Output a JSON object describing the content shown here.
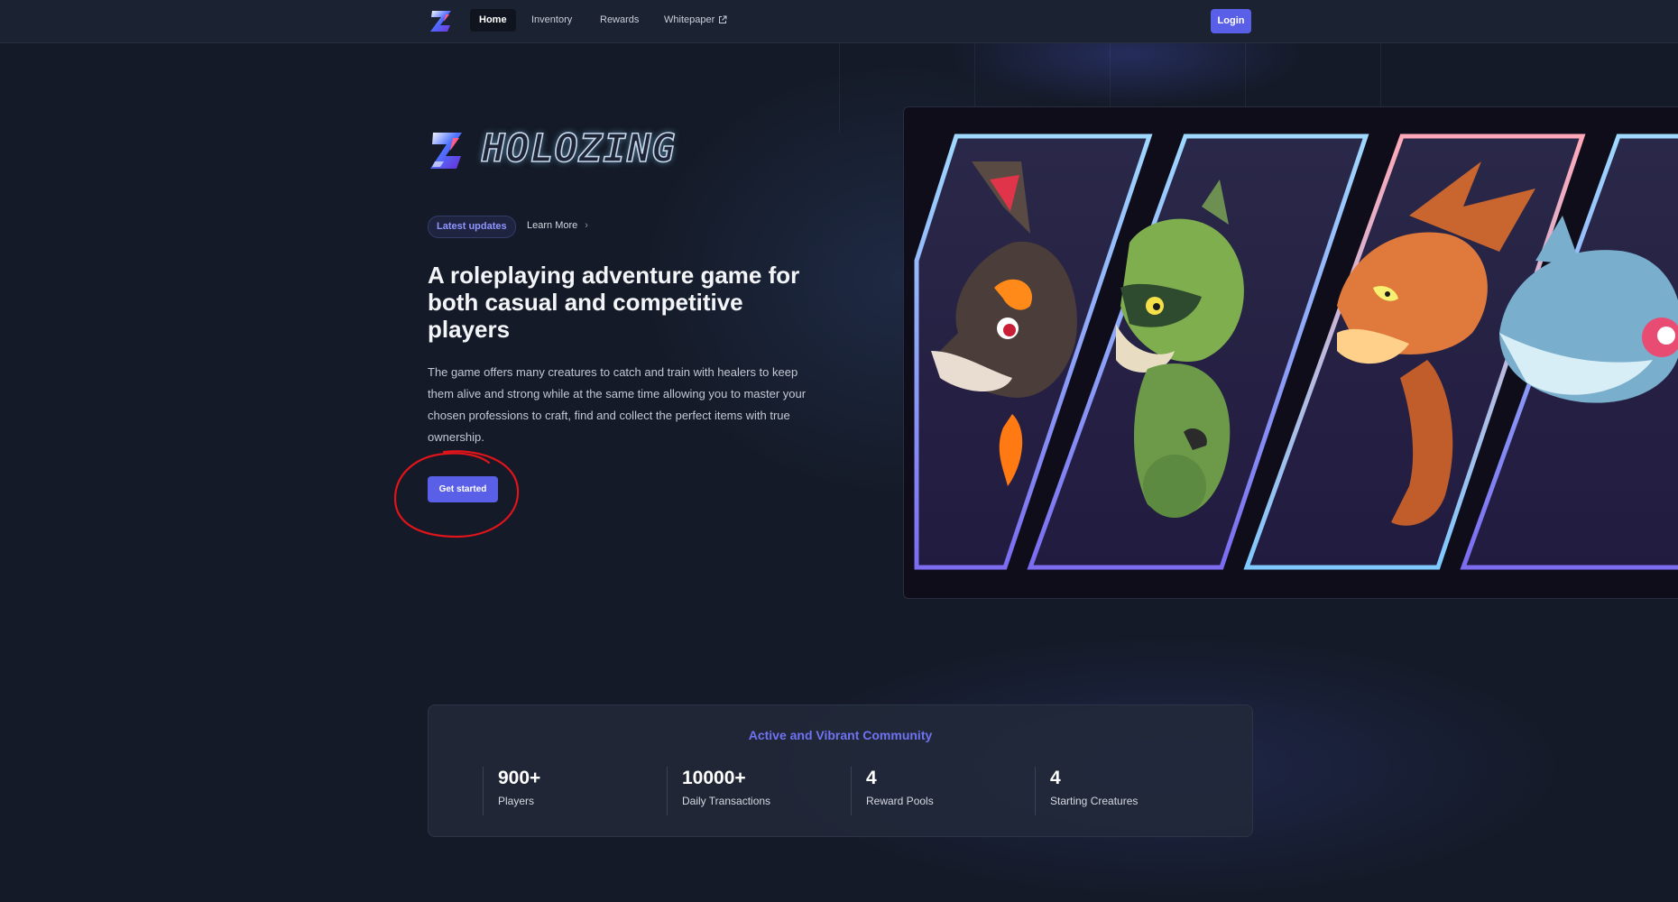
{
  "nav": {
    "items": [
      {
        "label": "Home",
        "active": true
      },
      {
        "label": "Inventory",
        "active": false
      },
      {
        "label": "Rewards",
        "active": false
      },
      {
        "label": "Whitepaper",
        "active": false,
        "icon": "external-link-icon"
      }
    ],
    "login_label": "Login"
  },
  "hero": {
    "wordmark": "HOLOZING",
    "badge": "Latest updates",
    "learn_more": "Learn More",
    "headline": "A roleplaying adventure game for both casual and competitive players",
    "description": "The game offers many creatures to catch and train with healers to keep them alive and strong while at the same time allowing you to master your chosen professions to craft, find and collect the perfect items with true ownership.",
    "cta": "Get started"
  },
  "community": {
    "title": "Active and Vibrant Community",
    "stats": [
      {
        "value": "900+",
        "label": "Players"
      },
      {
        "value": "10000+",
        "label": "Daily Transactions"
      },
      {
        "value": "4",
        "label": "Reward Pools"
      },
      {
        "value": "4",
        "label": "Starting Creatures"
      }
    ]
  },
  "colors": {
    "accent": "#5a5fe8",
    "background": "#141a27",
    "annotation": "#e0141b"
  }
}
